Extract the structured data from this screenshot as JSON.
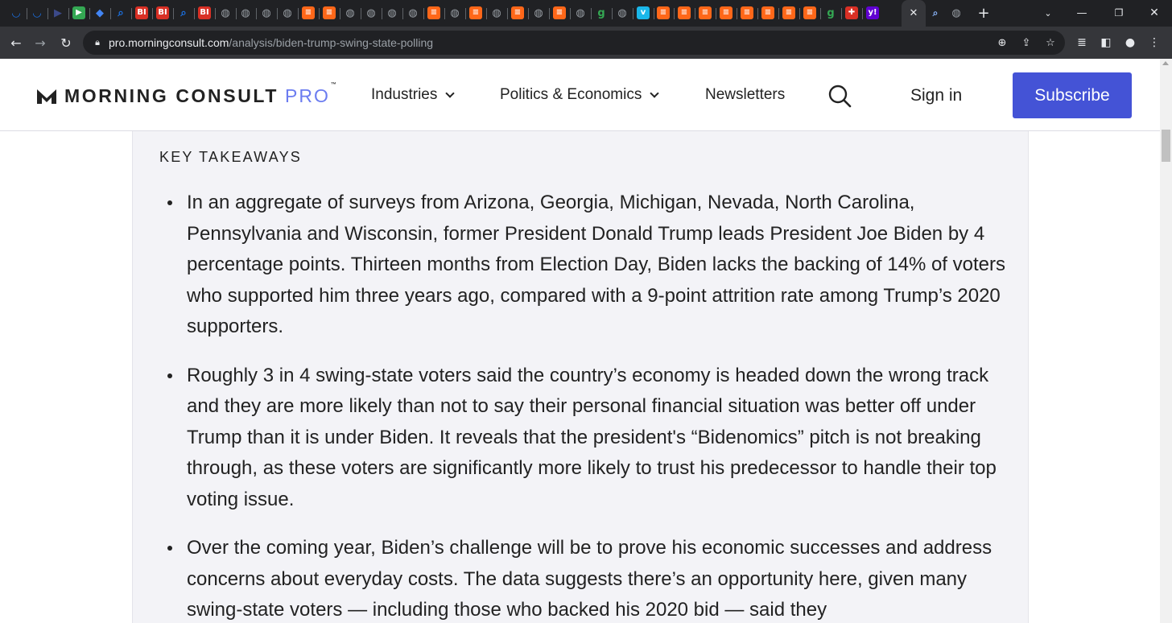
{
  "browser": {
    "url_host": "pro.morningconsult.com",
    "url_path": "/analysis/biden-trump-swing-state-polling",
    "tabs": [
      {
        "icon": "shield-icon",
        "color": "#1a73e8",
        "glyph": "◡"
      },
      {
        "icon": "shield-icon",
        "color": "#1a73e8",
        "glyph": "◡"
      },
      {
        "icon": "video-icon",
        "color": "#3c4a8a",
        "glyph": "▶"
      },
      {
        "icon": "play-icon",
        "color": "#34a853",
        "glyph": "▶"
      },
      {
        "icon": "graduation-cap-icon",
        "color": "#4285f4",
        "glyph": "◆"
      },
      {
        "icon": "search-icon",
        "color": "#1a73e8",
        "glyph": "⌕"
      },
      {
        "icon": "business-insider-icon",
        "color": "#d93025",
        "glyph": "BI"
      },
      {
        "icon": "business-insider-icon",
        "color": "#d93025",
        "glyph": "BI"
      },
      {
        "icon": "search-icon",
        "color": "#1a73e8",
        "glyph": "⌕"
      },
      {
        "icon": "business-insider-icon",
        "color": "#d93025",
        "glyph": "BI"
      },
      {
        "icon": "globe-icon",
        "color": "#9aa0a6",
        "glyph": "◍"
      },
      {
        "icon": "globe-icon",
        "color": "#9aa0a6",
        "glyph": "◍"
      },
      {
        "icon": "globe-icon",
        "color": "#9aa0a6",
        "glyph": "◍"
      },
      {
        "icon": "globe-icon",
        "color": "#9aa0a6",
        "glyph": "◍"
      },
      {
        "icon": "substack-icon",
        "color": "#ff6719",
        "glyph": "≡"
      },
      {
        "icon": "substack-icon",
        "color": "#ff6719",
        "glyph": "≡"
      },
      {
        "icon": "globe-icon",
        "color": "#9aa0a6",
        "glyph": "◍"
      },
      {
        "icon": "globe-icon",
        "color": "#9aa0a6",
        "glyph": "◍"
      },
      {
        "icon": "globe-icon",
        "color": "#9aa0a6",
        "glyph": "◍"
      },
      {
        "icon": "globe-icon",
        "color": "#9aa0a6",
        "glyph": "◍"
      },
      {
        "icon": "substack-icon",
        "color": "#ff6719",
        "glyph": "≡"
      },
      {
        "icon": "globe-icon",
        "color": "#9aa0a6",
        "glyph": "◍"
      },
      {
        "icon": "substack-icon",
        "color": "#ff6719",
        "glyph": "≡"
      },
      {
        "icon": "globe-icon",
        "color": "#9aa0a6",
        "glyph": "◍"
      },
      {
        "icon": "substack-icon",
        "color": "#ff6719",
        "glyph": "≡"
      },
      {
        "icon": "globe-icon",
        "color": "#9aa0a6",
        "glyph": "◍"
      },
      {
        "icon": "substack-icon",
        "color": "#ff6719",
        "glyph": "≡"
      },
      {
        "icon": "globe-icon",
        "color": "#9aa0a6",
        "glyph": "◍"
      },
      {
        "icon": "g-icon",
        "color": "#34a853",
        "glyph": "g"
      },
      {
        "icon": "globe-icon",
        "color": "#9aa0a6",
        "glyph": "◍"
      },
      {
        "icon": "vimeo-icon",
        "color": "#1ab7ea",
        "glyph": "v"
      },
      {
        "icon": "substack-icon",
        "color": "#ff6719",
        "glyph": "≡"
      },
      {
        "icon": "substack-icon",
        "color": "#ff6719",
        "glyph": "≡"
      },
      {
        "icon": "substack-icon",
        "color": "#ff6719",
        "glyph": "≡"
      },
      {
        "icon": "substack-icon",
        "color": "#ff6719",
        "glyph": "≡"
      },
      {
        "icon": "substack-icon",
        "color": "#ff6719",
        "glyph": "≡"
      },
      {
        "icon": "substack-icon",
        "color": "#ff6719",
        "glyph": "≡"
      },
      {
        "icon": "substack-icon",
        "color": "#ff6719",
        "glyph": "≡"
      },
      {
        "icon": "substack-icon",
        "color": "#ff6719",
        "glyph": "≡"
      },
      {
        "icon": "g-icon",
        "color": "#34a853",
        "glyph": "g"
      },
      {
        "icon": "medical-icon",
        "color": "#d93025",
        "glyph": "✚"
      },
      {
        "icon": "yahoo-icon",
        "color": "#6001d2",
        "glyph": "y!"
      }
    ],
    "active_tab_close": "✕",
    "new_tab": "+",
    "colors": {
      "tabstrip": "#202124",
      "toolbar": "#35363a",
      "omnibox": "#202124"
    }
  },
  "site": {
    "logo_text": "MORNING CONSULT",
    "logo_pro": "PRO",
    "logo_tm": "™",
    "nav": {
      "industries": "Industries",
      "politics": "Politics & Economics",
      "newsletters": "Newsletters"
    },
    "sign_in": "Sign in",
    "subscribe": "Subscribe",
    "accent_color": "#4453d6"
  },
  "takeaways": {
    "title": "KEY TAKEAWAYS",
    "items": [
      "In an aggregate of surveys from Arizona, Georgia, Michigan, Nevada, North Carolina, Pennsylvania and Wisconsin, former President Donald Trump leads President Joe Biden by 4 percentage points. Thirteen months from Election Day, Biden lacks the backing of 14% of voters who supported him three years ago, compared with a 9-point attrition rate among Trump’s 2020 supporters.",
      "Roughly 3 in 4 swing-state voters said the country’s economy is headed down the wrong track and they are more likely than not to say their personal financial situation was better off under Trump than it is under Biden. It reveals that the president's “Bidenomics” pitch is not breaking through, as these voters are significantly more likely to trust his predecessor to handle their top voting issue.",
      "Over the coming year, Biden’s challenge will be to prove his economic successes and address concerns about everyday costs. The data suggests there’s an opportunity here, given many swing-state voters — including those who backed his 2020 bid — said they"
    ]
  }
}
